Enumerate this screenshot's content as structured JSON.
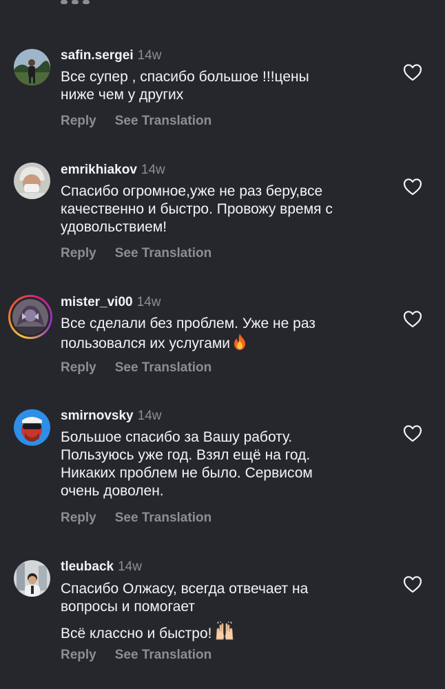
{
  "comments": [
    {
      "username": "safin.sergei",
      "time": "14w",
      "lines": [
        "Все супер , спасибо большое !!!цены",
        "ниже чем у других"
      ],
      "reply": "Reply",
      "see_translation": "See Translation"
    },
    {
      "username": "emrikhiakov",
      "time": "14w",
      "lines": [
        "Спасибо огромное,уже не раз беру,все",
        "качественно и быстро. Провожу время с",
        "удовольствием!"
      ],
      "reply": "Reply",
      "see_translation": "See Translation"
    },
    {
      "username": "mister_vi00",
      "time": "14w",
      "lines": [
        "Все сделали без проблем. Уже не раз",
        "пользовался их услугами"
      ],
      "emoji": "fire-emoji",
      "reply": "Reply",
      "see_translation": "See Translation"
    },
    {
      "username": "smirnovsky",
      "time": "14w",
      "lines": [
        "Большое спасибо за Вашу работу.",
        "Пользуюсь уже год. Взял ещё на год.",
        "Никаких проблем не было. Сервисом",
        "очень доволен."
      ],
      "reply": "Reply",
      "see_translation": "See Translation"
    },
    {
      "username": "tleuback",
      "time": "14w",
      "lines": [
        "Спасибо Олжасу, всегда отвечает на",
        "вопросы и помогает"
      ],
      "second_paragraph": "Всё классно и быстро!",
      "emoji": "raising-hands-emoji",
      "reply": "Reply",
      "see_translation": "See Translation"
    }
  ],
  "colors": {
    "background": "#26272c",
    "primary_text": "#f4f4f6",
    "secondary_text": "#8d8e94"
  }
}
